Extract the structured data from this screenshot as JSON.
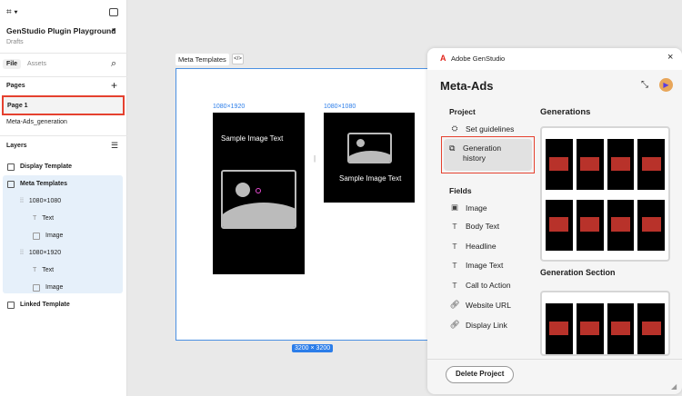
{
  "sidebar": {
    "file_name": "GenStudio Plugin Playground",
    "location": "Drafts",
    "tabs": [
      "File",
      "Assets"
    ],
    "pages_label": "Pages",
    "pages": [
      "Page 1",
      "Meta-Ads_generation"
    ],
    "layers_label": "Layers",
    "layers": [
      "Display Template",
      "Meta Templates",
      "1080×1080",
      "Text",
      "Image",
      "1080×1920",
      "Text",
      "Image",
      "Linked Template"
    ]
  },
  "canvas": {
    "frame_label": "Meta Templates",
    "tall_label": "1080×1920",
    "square_label": "1080×1080",
    "sample_text": "Sample Image Text",
    "frame_size": "3200 × 3200"
  },
  "plugin": {
    "app_name": "Adobe GenStudio",
    "title": "Meta-Ads",
    "project_label": "Project",
    "set_guidelines": "Set guidelines",
    "generation_history": "Generation history",
    "fields_label": "Fields",
    "fields": [
      "Image",
      "Body Text",
      "Headline",
      "Image Text",
      "Call to Action",
      "Website URL",
      "Display Link"
    ],
    "generations_label": "Generations",
    "generation_section_label": "Generation Section",
    "delete_button": "Delete Project"
  },
  "colors": {
    "accent": "#2b7de9",
    "highlight": "#e5412f",
    "adobe_red": "#e1251b"
  }
}
